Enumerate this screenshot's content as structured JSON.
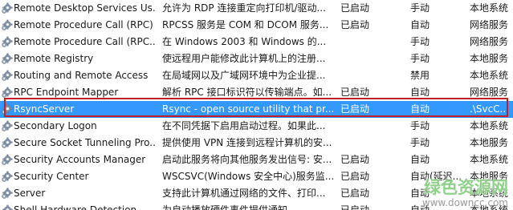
{
  "services": [
    {
      "name": "Remote Desktop Services Us...",
      "description": "允许为 RDP 连接重定向打印机/驱动...",
      "status": "已启动",
      "startup": "手动",
      "logon": "本地系统"
    },
    {
      "name": "Remote Procedure Call (RPC)",
      "description": "RPCSS 服务是 COM 和 DCOM 服务...",
      "status": "已启动",
      "startup": "自动",
      "logon": "网络服务"
    },
    {
      "name": "Remote Procedure Call (RPC...",
      "description": "在 Windows 2003 和 Windows 的...",
      "status": "",
      "startup": "手动",
      "logon": "网络服务"
    },
    {
      "name": "Remote Registry",
      "description": "使远程用户能修改此计算机上的注册...",
      "status": "",
      "startup": "手动",
      "logon": "本地服务"
    },
    {
      "name": "Routing and Remote Access",
      "description": "在局域网以及广域网环境中为企业提...",
      "status": "",
      "startup": "禁用",
      "logon": "本地系统"
    },
    {
      "name": "RPC Endpoint Mapper",
      "description": "解析 RPC 接口标识符以传输端点。如...",
      "status": "已启动",
      "startup": "自动",
      "logon": "网络服务"
    },
    {
      "name": "RsyncServer",
      "description": "Rsync - open source utility that pr...",
      "status": "已启动",
      "startup": "自动",
      "logon": ".\\SvcC..."
    },
    {
      "name": "Secondary Logon",
      "description": "在不同凭据下启用启动过程。如果此...",
      "status": "",
      "startup": "手动",
      "logon": "本地系统"
    },
    {
      "name": "Secure Socket Tunneling Pro...",
      "description": "提供使用 VPN 连接到远程计算机的安...",
      "status": "",
      "startup": "手动",
      "logon": "本地服务"
    },
    {
      "name": "Security Accounts Manager",
      "description": "启动此服务将向其他服务发出信号: 安...",
      "status": "已启动",
      "startup": "自动",
      "logon": "本地系统"
    },
    {
      "name": "Security Center",
      "description": "WSCSVC(Windows 安全中心)服务监...",
      "status": "已启动",
      "startup": "自动(延迟...",
      "logon": "本地服务"
    },
    {
      "name": "Server",
      "description": "支持此计算机通过网络的文件、打印...",
      "status": "已启动",
      "startup": "自动",
      "logon": "本地系统"
    },
    {
      "name": "Shell Hardware Detection",
      "description": "为自动播放硬件事件提供通知。",
      "status": "已启动",
      "startup": "自动",
      "logon": "本地系统"
    }
  ],
  "selected_index": 6,
  "watermark": {
    "title": "绿色资源网",
    "url": "www.downcc.com"
  },
  "colors": {
    "selection": "#3399ff",
    "highlight_border": "#c0202a",
    "watermark_green": "#8fd18a"
  },
  "icon": "gear-icon"
}
